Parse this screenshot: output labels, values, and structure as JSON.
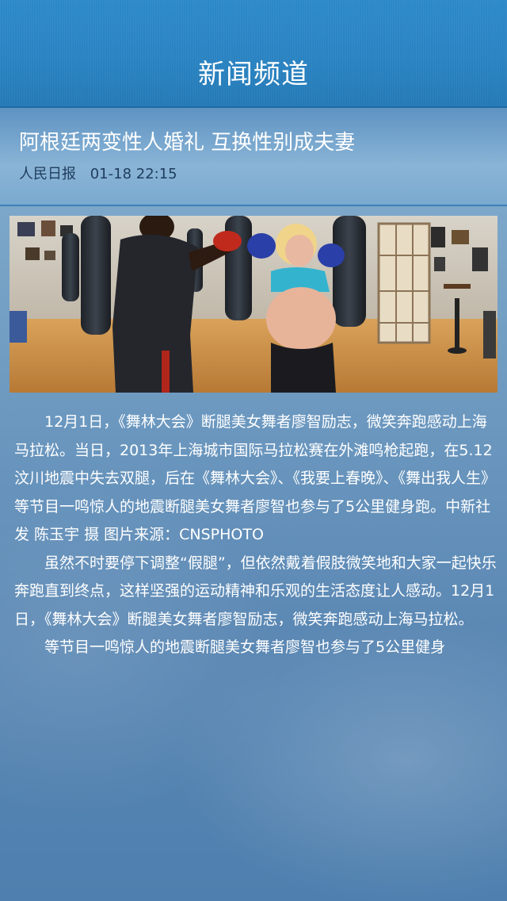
{
  "header": {
    "title": "新闻频道"
  },
  "article": {
    "title": "阿根廷两变性人婚礼 互换性别成夫妻",
    "source": "人民日报",
    "datetime": "01-18 22:15",
    "image": {
      "icon": "photo-icon"
    },
    "paragraphs": [
      "12月1日，《舞林大会》断腿美女舞者廖智励志，微笑奔跑感动上海马拉松。当日，2013年上海城市国际马拉松赛在外滩鸣枪起跑，在5.12汶川地震中失去双腿，后在《舞林大会》、《我要上春晚》、《舞出我人生》等节目一鸣惊人的地震断腿美女舞者廖智也参与了5公里健身跑。中新社发 陈玉宇 摄 图片来源：CNSPHOTO",
      "虽然不时要停下调整“假腿”，但依然戴着假肢微笑地和大家一起快乐奔跑直到终点，这样坚强的运动精神和乐观的生活态度让人感动。12月1日，《舞林大会》断腿美女舞者廖智励志，微笑奔跑感动上海马拉松。",
      "等节目一鸣惊人的地震断腿美女舞者廖智也参与了5公里健身"
    ]
  }
}
